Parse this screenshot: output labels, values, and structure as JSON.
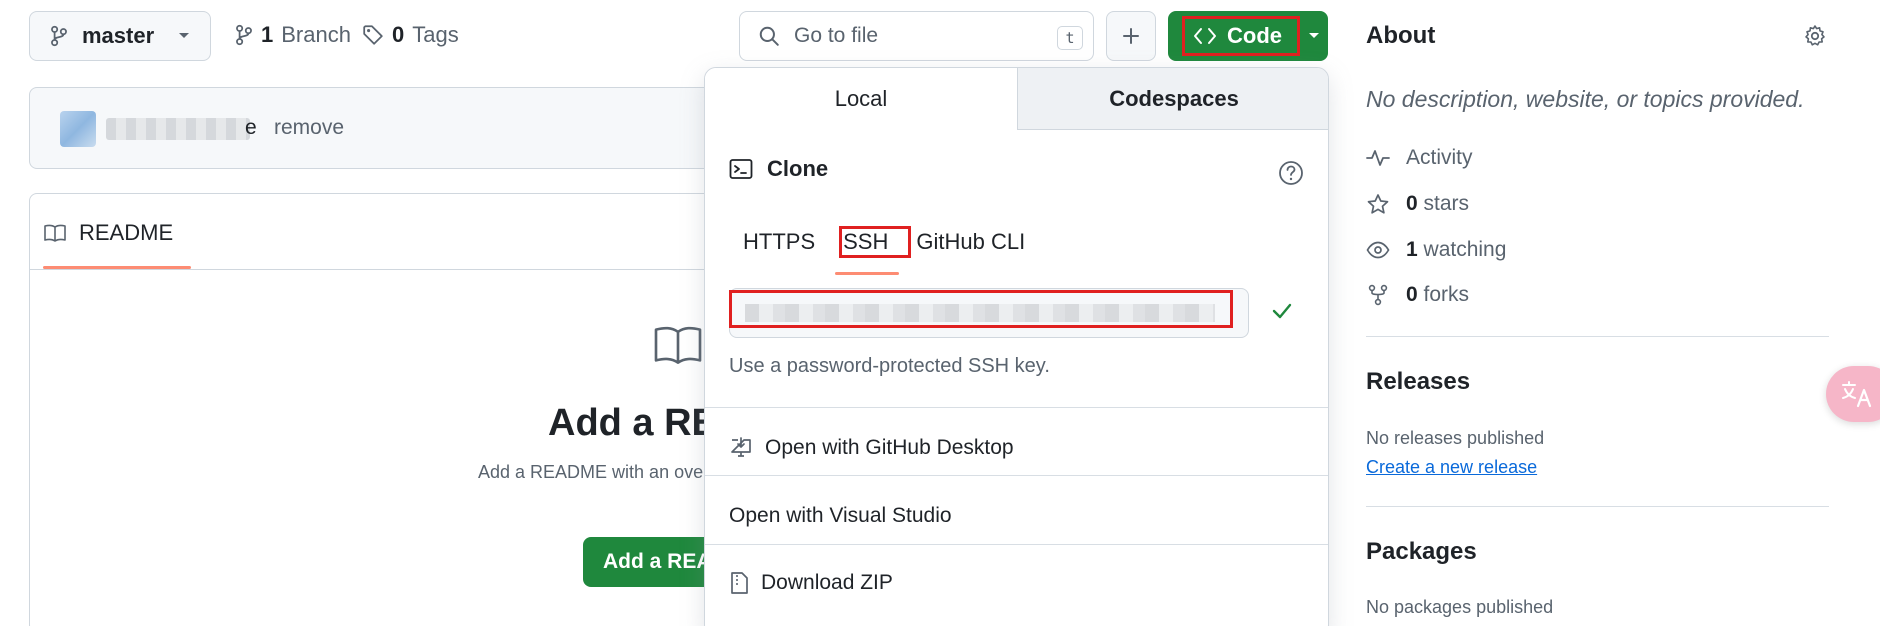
{
  "toolbar": {
    "branch_name": "master",
    "branch_count": "1",
    "branch_label": "Branch",
    "tag_count": "0",
    "tag_label": "Tags",
    "search_placeholder": "Go to file",
    "search_shortcut": "t",
    "code_label": "Code"
  },
  "commit": {
    "suffix": "e",
    "action": "remove"
  },
  "readme": {
    "tab_label": "README",
    "title": "Add a RE",
    "description": "Add a README with an ove",
    "button_label": "Add a REA"
  },
  "dropdown": {
    "tabs": [
      "Local",
      "Codespaces"
    ],
    "clone_label": "Clone",
    "protocols": [
      "HTTPS",
      "SSH",
      "GitHub CLI"
    ],
    "selected_protocol": "SSH",
    "ssh_hint": "Use a password-protected SSH key.",
    "items": [
      "Open with GitHub Desktop",
      "Open with Visual Studio",
      "Download ZIP"
    ]
  },
  "sidebar": {
    "about_title": "About",
    "about_desc": "No description, website, or topics provided.",
    "stats": [
      {
        "icon": "pulse-icon",
        "count": "",
        "label": "Activity"
      },
      {
        "icon": "star-icon",
        "count": "0",
        "label": "stars"
      },
      {
        "icon": "eye-icon",
        "count": "1",
        "label": "watching"
      },
      {
        "icon": "fork-icon",
        "count": "0",
        "label": "forks"
      }
    ],
    "releases_title": "Releases",
    "releases_empty": "No releases published",
    "releases_link": "Create a new release",
    "packages_title": "Packages",
    "packages_empty": "No packages published"
  },
  "colors": {
    "primary_green": "#1f883d",
    "highlight_red": "#e02020",
    "tab_accent": "#fd8c73",
    "link_blue": "#0969da"
  }
}
